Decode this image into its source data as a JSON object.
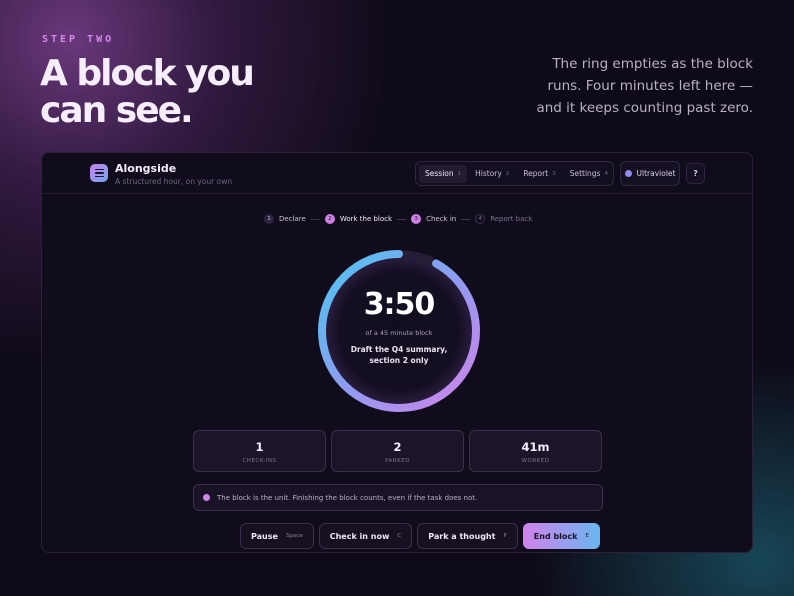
{
  "hero": {
    "eyebrow": "STEP TWO",
    "headline_line1": "A block you",
    "headline_line2": "can see.",
    "blurb": "The ring empties as the block runs. Four minutes left here — and it keeps counting past zero."
  },
  "app": {
    "brand": {
      "name": "Alongside",
      "tagline": "A structured hour, on your own"
    },
    "nav": [
      {
        "label": "Session",
        "key": "1",
        "active": true
      },
      {
        "label": "History",
        "key": "2",
        "active": false
      },
      {
        "label": "Report",
        "key": "3",
        "active": false
      },
      {
        "label": "Settings",
        "key": "4",
        "active": false
      }
    ],
    "theme_label": "Ultraviolet",
    "help_label": "?",
    "steps": [
      {
        "num": "1",
        "label": "Declare"
      },
      {
        "num": "2",
        "label": "Work the block"
      },
      {
        "num": "3",
        "label": "Check in"
      },
      {
        "num": "4",
        "label": "Report back"
      }
    ],
    "timer": {
      "time": "3:50",
      "subtitle": "of a 45 minute block",
      "task": "Draft the Q4 summary, section 2 only",
      "progress_remaining": 0.92
    },
    "stats": [
      {
        "value": "1",
        "label": "CHECK-INS"
      },
      {
        "value": "2",
        "label": "PARKED"
      },
      {
        "value": "41m",
        "label": "WORKED"
      }
    ],
    "note": "The block is the unit. Finishing the block counts, even if the task does not.",
    "actions": [
      {
        "label": "Pause",
        "key": "Space"
      },
      {
        "label": "Check in now",
        "key": "C"
      },
      {
        "label": "Park a thought",
        "key": "P"
      },
      {
        "label": "End block",
        "key": "E"
      }
    ],
    "colors": {
      "accent_pink": "#cf7ee6",
      "accent_blue": "#4cc7f0",
      "background": "#0e0a17"
    }
  }
}
